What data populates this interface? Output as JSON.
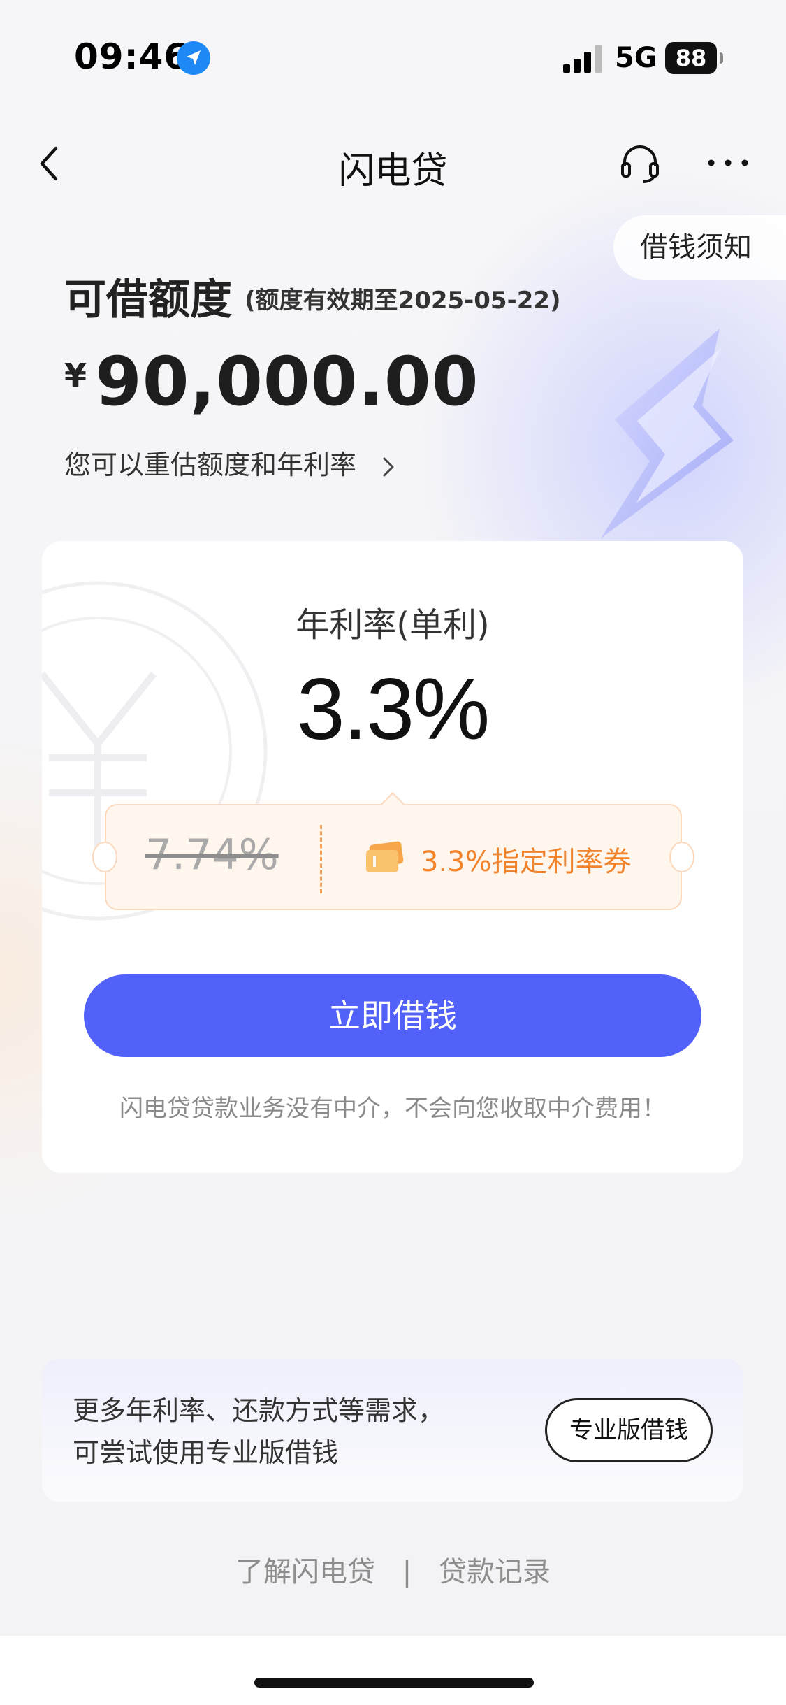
{
  "status_bar": {
    "time": "09:46",
    "network": "5G",
    "battery": "88"
  },
  "nav": {
    "title": "闪电贷"
  },
  "notice": {
    "label": "借钱须知"
  },
  "limit": {
    "title": "可借额度",
    "validity": "(额度有效期至2025-05-22)",
    "currency": "¥",
    "amount": "90,000.00",
    "reassess_label": "您可以重估额度和年利率"
  },
  "loan_card": {
    "rate_label": "年利率(单利)",
    "rate_value": "3.3%",
    "coupon": {
      "old_rate": "7.74%",
      "text": "3.3%指定利率券"
    },
    "borrow_button": "立即借钱",
    "disclaimer": "闪电贷贷款业务没有中介，不会向您收取中介费用！"
  },
  "pro": {
    "line1": "更多年利率、还款方式等需求，",
    "line2": "可尝试使用专业版借钱",
    "button": "专业版借钱"
  },
  "footer": {
    "about": "了解闪电贷",
    "separator": "|",
    "records": "贷款记录"
  },
  "colors": {
    "accent": "#5261fa",
    "coupon_text": "#f0832c",
    "coupon_bg": "#fff6ee"
  }
}
